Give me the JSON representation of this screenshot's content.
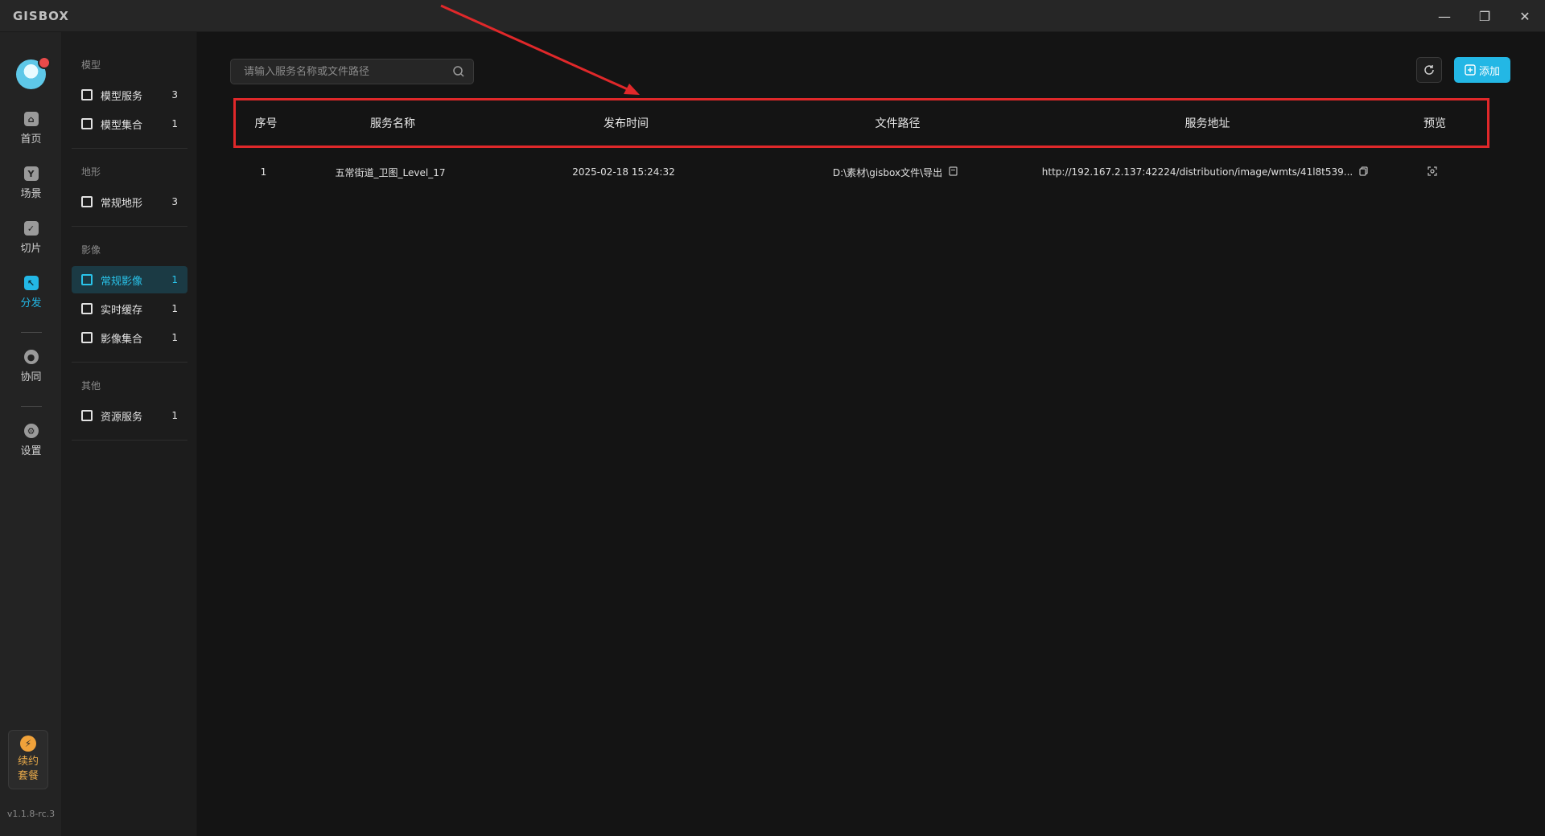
{
  "app": {
    "logo": "GISBOX"
  },
  "window_controls": {
    "minimize": "—",
    "restore": "❐",
    "close": "✕"
  },
  "rail": {
    "items": [
      {
        "label": "首页",
        "icon": "home-icon"
      },
      {
        "label": "场景",
        "icon": "scene-icon"
      },
      {
        "label": "切片",
        "icon": "tile-icon"
      },
      {
        "label": "分发",
        "icon": "distribute-icon",
        "active": true
      },
      {
        "label": "协同",
        "icon": "lock-icon"
      },
      {
        "label": "设置",
        "icon": "gear-icon"
      }
    ],
    "promo": {
      "line1": "续约",
      "line2": "套餐",
      "icon": "lightning-icon"
    },
    "version": "v1.1.8-rc.3"
  },
  "sidebar": {
    "groups": [
      {
        "label": "模型",
        "items": [
          {
            "label": "模型服务",
            "count": "3"
          },
          {
            "label": "模型集合",
            "count": "1"
          }
        ]
      },
      {
        "label": "地形",
        "items": [
          {
            "label": "常规地形",
            "count": "3"
          }
        ]
      },
      {
        "label": "影像",
        "items": [
          {
            "label": "常规影像",
            "count": "1",
            "active": true
          },
          {
            "label": "实时缓存",
            "count": "1"
          },
          {
            "label": "影像集合",
            "count": "1"
          }
        ]
      },
      {
        "label": "其他",
        "items": [
          {
            "label": "资源服务",
            "count": "1"
          }
        ]
      }
    ]
  },
  "toolbar": {
    "search_placeholder": "请输入服务名称或文件路径",
    "add_label": "添加"
  },
  "table": {
    "columns": [
      "序号",
      "服务名称",
      "发布时间",
      "文件路径",
      "服务地址",
      "预览"
    ],
    "rows": [
      {
        "index": "1",
        "name": "五常街道_卫图_Level_17",
        "time": "2025-02-18 15:24:32",
        "path": "D:\\素材\\gisbox文件\\导出",
        "address": "http://192.167.2.137:42224/distribution/image/wmts/41l8t539..."
      }
    ]
  },
  "colors": {
    "accent": "#23b7e5",
    "highlight_border": "#e0282a",
    "annotation_arrow": "#e0282a"
  }
}
